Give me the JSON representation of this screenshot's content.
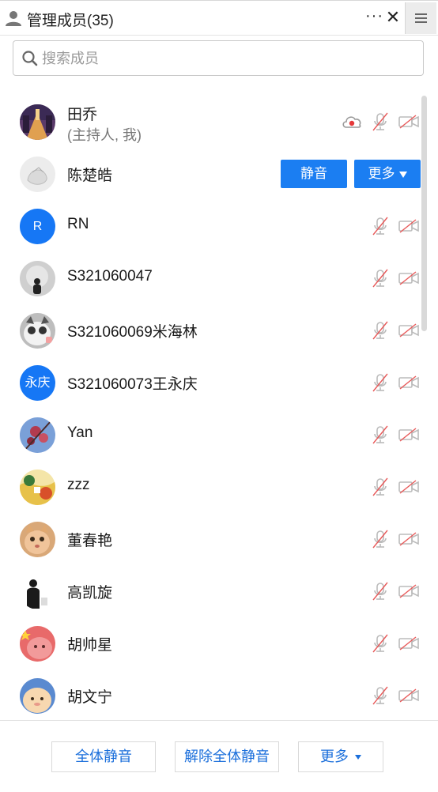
{
  "header": {
    "title": "管理成员(35)",
    "more_label": "···",
    "close_label": "✕"
  },
  "search": {
    "placeholder": "搜索成员",
    "value": ""
  },
  "members": [
    {
      "name": "田乔",
      "sub": "(主持人, 我)",
      "avatar": "image",
      "recording": true
    },
    {
      "name": "陈楚皓",
      "avatar": "image",
      "hovered": true
    },
    {
      "name": "RN",
      "avatar_text": "R"
    },
    {
      "name": "S321060047",
      "avatar": "image"
    },
    {
      "name": "S321060069米海林",
      "avatar": "image"
    },
    {
      "name": "S321060073王永庆",
      "avatar_text": "永庆"
    },
    {
      "name": "Yan",
      "avatar": "image"
    },
    {
      "name": "zzz",
      "avatar": "image"
    },
    {
      "name": "董春艳",
      "avatar": "image"
    },
    {
      "name": "高凯旋",
      "avatar": "image"
    },
    {
      "name": "胡帅星",
      "avatar": "image"
    },
    {
      "name": "胡文宁",
      "avatar": "image"
    }
  ],
  "row_actions": {
    "mute_label": "静音",
    "more_label": "更多"
  },
  "footer": {
    "mute_all": "全体静音",
    "unmute_all": "解除全体静音",
    "more": "更多"
  },
  "colors": {
    "accent": "#1b7ef2",
    "avatar_blue": "#1677f5",
    "muted_red": "#e85a5a"
  }
}
